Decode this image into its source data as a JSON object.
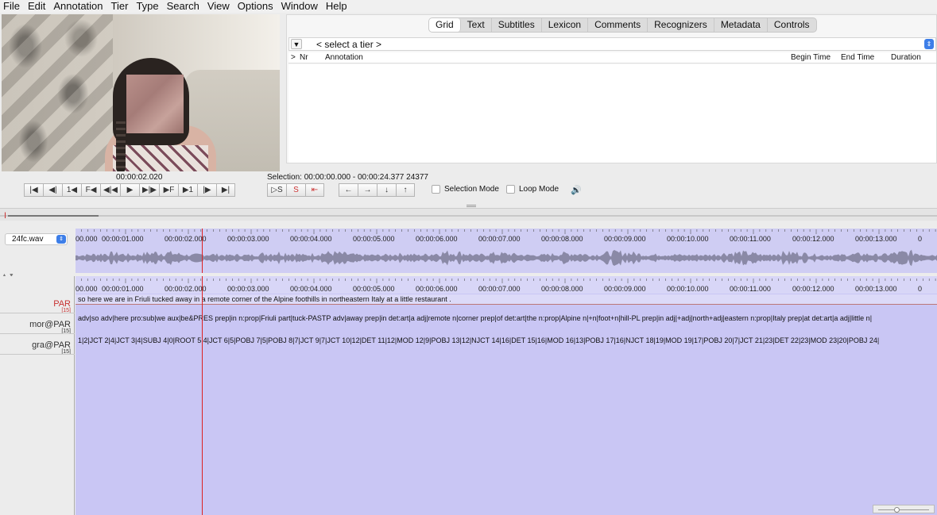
{
  "menubar": [
    "File",
    "Edit",
    "Annotation",
    "Tier",
    "Type",
    "Search",
    "View",
    "Options",
    "Window",
    "Help"
  ],
  "tabs": [
    {
      "label": "Grid",
      "active": true
    },
    {
      "label": "Text",
      "active": false
    },
    {
      "label": "Subtitles",
      "active": false
    },
    {
      "label": "Lexicon",
      "active": false
    },
    {
      "label": "Comments",
      "active": false
    },
    {
      "label": "Recognizers",
      "active": false
    },
    {
      "label": "Metadata",
      "active": false
    },
    {
      "label": "Controls",
      "active": false
    }
  ],
  "grid": {
    "tier_placeholder": "< select a tier >",
    "columns": {
      "expand": ">",
      "nr": "Nr",
      "annotation": "Annotation",
      "begin": "Begin Time",
      "end": "End Time",
      "duration": "Duration"
    }
  },
  "media": {
    "current_time": "00:00:02.020",
    "selection": "Selection: 00:00:00.000 - 00:00:24.377  24377",
    "selection_mode_label": "Selection Mode",
    "loop_mode_label": "Loop Mode",
    "file": "24fc.wav",
    "controls": [
      "|◀",
      "◀|",
      "1◀",
      "F◀",
      "◀|◀",
      "▶",
      "▶|▶",
      "▶F",
      "▶1",
      "|▶",
      "▶|"
    ],
    "selection_controls": [
      "▷S",
      "S",
      "⇤"
    ],
    "nav_controls": [
      "←",
      "→",
      "↓",
      "↑"
    ]
  },
  "ruler_labels": [
    "00.000",
    "00:00:01.000",
    "00:00:02.000",
    "00:00:03.000",
    "00:00:04.000",
    "00:00:05.000",
    "00:00:06.000",
    "00:00:07.000",
    "00:00:08.000",
    "00:00:09.000",
    "00:00:10.000",
    "00:00:11.000",
    "00:00:12.000",
    "00:00:13.000",
    "0"
  ],
  "tiers": [
    {
      "name": "PAR",
      "count": "[15]",
      "color": "#c83232"
    },
    {
      "name": "mor@PAR",
      "count": "[15]",
      "color": "#333333"
    },
    {
      "name": "gra@PAR",
      "count": "[15]",
      "color": "#333333"
    }
  ],
  "annotations": {
    "par": "so here we are in Friuli tucked away in a remote corner of the  Alpine foothills in northeastern Italy at a little restaurant .",
    "mor": "adv|so adv|here pro:sub|we aux|be&PRES prep|in n:prop|Friuli  part|tuck-PASTP adv|away prep|in det:art|a adj|remote n|corner  prep|of det:art|the n:prop|Alpine n|+n|foot+n|hill-PL prep|in  adj|+adj|north+adj|eastern n:prop|Italy prep|at det:art|a adj|little  n|",
    "gra": "1|2|JCT 2|4|JCT 3|4|SUBJ 4|0|ROOT 5|4|JCT 6|5|POBJ 7|5|POBJ 8|7|JCT  9|7|JCT 10|12|DET 11|12|MOD 12|9|POBJ 13|12|NJCT 14|16|DET 15|16|MOD  16|13|POBJ 17|16|NJCT 18|19|MOD 19|17|POBJ 20|7|JCT 21|23|DET 22|23|MOD  23|20|POBJ 24|"
  },
  "colors": {
    "timeline_bg": "#c9c6f4",
    "crosshair": "#dd2222",
    "accent": "#3d7ee8"
  }
}
